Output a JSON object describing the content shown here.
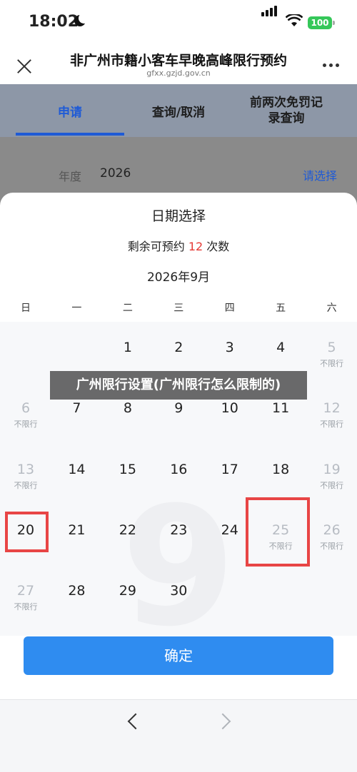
{
  "status": {
    "time": "18:02",
    "battery": "100"
  },
  "header": {
    "title": "非广州市籍小客车早晚高峰限行预约",
    "url": "gfxx.gzjd.gov.cn"
  },
  "tabs": [
    {
      "label": "申请",
      "active": true
    },
    {
      "label": "查询/取消",
      "active": false
    },
    {
      "label": "前两次免罚记录查询",
      "active": false
    }
  ],
  "year": {
    "label": "年度",
    "value": "2026",
    "select": "请选择"
  },
  "sheet": {
    "title": "日期选择",
    "remain_prefix": "剩余可预约",
    "remain_count": "12",
    "remain_suffix": "次数",
    "month": "2026年9月",
    "watermark": "9",
    "weekdays": [
      "日",
      "一",
      "二",
      "三",
      "四",
      "五",
      "六"
    ],
    "days": [
      {
        "n": "1",
        "sub": "",
        "off": false
      },
      {
        "n": "2",
        "sub": "",
        "off": false
      },
      {
        "n": "3",
        "sub": "",
        "off": false
      },
      {
        "n": "4",
        "sub": "",
        "off": false
      },
      {
        "n": "5",
        "sub": "不限行",
        "off": true
      },
      {
        "n": "6",
        "sub": "不限行",
        "off": true
      },
      {
        "n": "7",
        "sub": "",
        "off": false
      },
      {
        "n": "8",
        "sub": "",
        "off": false
      },
      {
        "n": "9",
        "sub": "",
        "off": false
      },
      {
        "n": "10",
        "sub": "",
        "off": false
      },
      {
        "n": "11",
        "sub": "",
        "off": false
      },
      {
        "n": "12",
        "sub": "不限行",
        "off": true
      },
      {
        "n": "13",
        "sub": "不限行",
        "off": true
      },
      {
        "n": "14",
        "sub": "",
        "off": false
      },
      {
        "n": "15",
        "sub": "",
        "off": false
      },
      {
        "n": "16",
        "sub": "",
        "off": false
      },
      {
        "n": "17",
        "sub": "",
        "off": false
      },
      {
        "n": "18",
        "sub": "",
        "off": false
      },
      {
        "n": "19",
        "sub": "不限行",
        "off": true
      },
      {
        "n": "20",
        "sub": "",
        "off": false
      },
      {
        "n": "21",
        "sub": "",
        "off": false
      },
      {
        "n": "22",
        "sub": "",
        "off": false
      },
      {
        "n": "23",
        "sub": "",
        "off": false
      },
      {
        "n": "24",
        "sub": "",
        "off": false
      },
      {
        "n": "25",
        "sub": "不限行",
        "off": true
      },
      {
        "n": "26",
        "sub": "不限行",
        "off": true
      },
      {
        "n": "27",
        "sub": "不限行",
        "off": true
      },
      {
        "n": "28",
        "sub": "",
        "off": false
      },
      {
        "n": "29",
        "sub": "",
        "off": false
      },
      {
        "n": "30",
        "sub": "",
        "off": false
      }
    ],
    "confirm": "确定"
  },
  "banner": "广州限行设置(广州限行怎么限制的)",
  "colors": {
    "accent": "#1f5bd6",
    "highlight": "#e84545",
    "confirm": "#2f8cf0"
  }
}
